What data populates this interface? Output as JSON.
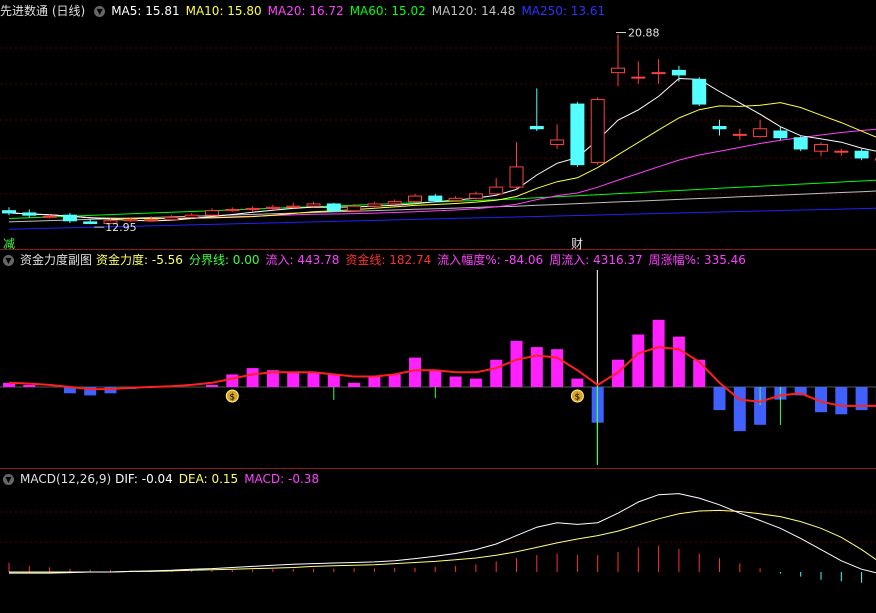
{
  "colors": {
    "bg": "#000000",
    "up": "#ff4040",
    "down": "#54ffff",
    "grid": "#5a0000",
    "ma5": "#ffffff",
    "ma10": "#ffff40",
    "ma20": "#ff40ff",
    "ma60": "#00ff00",
    "ma120": "#c0c0c0",
    "ma250": "#2020ff"
  },
  "panel1": {
    "name": "先进数通 (日线)",
    "ma": [
      {
        "label": "MA5: 15.81",
        "color": "#ffffff"
      },
      {
        "label": "MA10: 15.80",
        "color": "#ffff40"
      },
      {
        "label": "MA20: 16.72",
        "color": "#ff40ff"
      },
      {
        "label": "MA60: 15.02",
        "color": "#00ff00"
      },
      {
        "label": "MA120: 14.48",
        "color": "#c0c0c0"
      },
      {
        "label": "MA250: 13.61",
        "color": "#3030ff"
      }
    ],
    "high_label": "20.88",
    "low_label": "12.95",
    "marker_left": "减",
    "marker_mid": "财"
  },
  "panel2": {
    "name": "资金力度副图",
    "items": [
      {
        "label": "资金力度: -5.56",
        "color": "#ffff60"
      },
      {
        "label": "分界线: 0.00",
        "color": "#40ff40"
      },
      {
        "label": "流入: 443.78",
        "color": "#ff40ff"
      },
      {
        "label": "资金线: 182.74",
        "color": "#ff3030"
      },
      {
        "label": "流入幅度%: -84.06",
        "color": "#ff40ff"
      },
      {
        "label": "周流入: 4316.37",
        "color": "#ff40ff"
      },
      {
        "label": "周涨幅%: 335.46",
        "color": "#ff40ff"
      }
    ],
    "coin_glyph": "$"
  },
  "panel3": {
    "name": "MACD(12,26,9)",
    "items": [
      {
        "label": "DIF: -0.04",
        "color": "#ffffff"
      },
      {
        "label": "DEA: 0.15",
        "color": "#ffff60"
      },
      {
        "label": "MACD: -0.38",
        "color": "#ff40ff"
      }
    ]
  },
  "chart_data": [
    {
      "type": "candlestick",
      "title": "先进数通 (日线)",
      "candles": [
        {
          "o": 13.55,
          "c": 13.45,
          "h": 13.7,
          "l": 13.35
        },
        {
          "o": 13.45,
          "c": 13.35,
          "h": 13.6,
          "l": 13.25
        },
        {
          "o": 13.3,
          "c": 13.3,
          "h": 13.4,
          "l": 13.2
        },
        {
          "o": 13.35,
          "c": 13.1,
          "h": 13.45,
          "l": 13.0
        },
        {
          "o": 13.05,
          "c": 12.98,
          "h": 13.15,
          "l": 12.95
        },
        {
          "o": 12.98,
          "c": 13.1,
          "h": 13.2,
          "l": 12.95
        },
        {
          "o": 13.1,
          "c": 13.15,
          "h": 13.25,
          "l": 13.05
        },
        {
          "o": 13.15,
          "c": 13.15,
          "h": 13.3,
          "l": 13.1
        },
        {
          "o": 13.15,
          "c": 13.25,
          "h": 13.35,
          "l": 13.1
        },
        {
          "o": 13.25,
          "c": 13.35,
          "h": 13.45,
          "l": 13.2
        },
        {
          "o": 13.35,
          "c": 13.55,
          "h": 13.65,
          "l": 13.3
        },
        {
          "o": 13.55,
          "c": 13.6,
          "h": 13.7,
          "l": 13.5
        },
        {
          "o": 13.6,
          "c": 13.65,
          "h": 13.75,
          "l": 13.5
        },
        {
          "o": 13.65,
          "c": 13.7,
          "h": 13.8,
          "l": 13.6
        },
        {
          "o": 13.7,
          "c": 13.75,
          "h": 13.9,
          "l": 13.65
        },
        {
          "o": 13.75,
          "c": 13.85,
          "h": 13.95,
          "l": 13.7
        },
        {
          "o": 13.85,
          "c": 13.55,
          "h": 13.9,
          "l": 13.5
        },
        {
          "o": 13.55,
          "c": 13.75,
          "h": 13.85,
          "l": 13.5
        },
        {
          "o": 13.75,
          "c": 13.85,
          "h": 13.95,
          "l": 13.7
        },
        {
          "o": 13.85,
          "c": 13.95,
          "h": 14.05,
          "l": 13.8
        },
        {
          "o": 13.95,
          "c": 14.2,
          "h": 14.3,
          "l": 13.9
        },
        {
          "o": 14.2,
          "c": 14.0,
          "h": 14.3,
          "l": 13.95
        },
        {
          "o": 14.0,
          "c": 14.1,
          "h": 14.2,
          "l": 13.95
        },
        {
          "o": 14.1,
          "c": 14.3,
          "h": 14.4,
          "l": 14.05
        },
        {
          "o": 14.3,
          "c": 14.6,
          "h": 15.0,
          "l": 14.25
        },
        {
          "o": 14.6,
          "c": 15.5,
          "h": 16.6,
          "l": 14.5
        },
        {
          "o": 17.3,
          "c": 17.2,
          "h": 19.0,
          "l": 17.1
        },
        {
          "o": 16.5,
          "c": 16.7,
          "h": 17.4,
          "l": 16.3
        },
        {
          "o": 18.3,
          "c": 15.6,
          "h": 18.4,
          "l": 15.5
        },
        {
          "o": 15.7,
          "c": 18.5,
          "h": 18.6,
          "l": 15.6
        },
        {
          "o": 19.7,
          "c": 19.9,
          "h": 21.4,
          "l": 19.1
        },
        {
          "o": 19.5,
          "c": 19.5,
          "h": 20.2,
          "l": 19.2
        },
        {
          "o": 19.7,
          "c": 19.7,
          "h": 20.3,
          "l": 19.2
        },
        {
          "o": 19.8,
          "c": 19.6,
          "h": 20.0,
          "l": 19.3
        },
        {
          "o": 19.4,
          "c": 18.3,
          "h": 19.5,
          "l": 18.2
        },
        {
          "o": 17.3,
          "c": 17.2,
          "h": 17.6,
          "l": 16.9
        },
        {
          "o": 16.95,
          "c": 16.95,
          "h": 17.2,
          "l": 16.7
        },
        {
          "o": 16.85,
          "c": 17.2,
          "h": 17.6,
          "l": 16.8
        },
        {
          "o": 17.1,
          "c": 16.8,
          "h": 17.3,
          "l": 16.7
        },
        {
          "o": 16.8,
          "c": 16.3,
          "h": 16.9,
          "l": 16.2
        },
        {
          "o": 16.2,
          "c": 16.5,
          "h": 16.6,
          "l": 16.0
        },
        {
          "o": 16.2,
          "c": 16.2,
          "h": 16.3,
          "l": 16.0
        },
        {
          "o": 16.2,
          "c": 15.9,
          "h": 16.3,
          "l": 15.8
        },
        {
          "o": 15.85,
          "c": 15.85,
          "h": 16.0,
          "l": 15.7
        }
      ]
    },
    {
      "type": "bar",
      "title": "资金力度副图",
      "values": [
        0.1,
        0.05,
        0.0,
        -0.15,
        -0.2,
        -0.15,
        -0.05,
        0.0,
        0.0,
        0.0,
        0.05,
        0.3,
        0.45,
        0.4,
        0.35,
        0.35,
        0.3,
        0.1,
        0.25,
        0.3,
        0.7,
        0.4,
        0.25,
        0.2,
        0.65,
        1.1,
        0.95,
        0.9,
        0.2,
        -0.85,
        0.65,
        1.25,
        1.6,
        1.2,
        0.65,
        -0.55,
        -1.05,
        -0.9,
        -0.3,
        -0.2,
        -0.6,
        -0.65,
        -0.55,
        -0.5
      ],
      "line": [
        0.1,
        0.08,
        0.05,
        0.0,
        -0.05,
        -0.05,
        -0.02,
        0.0,
        0.02,
        0.05,
        0.1,
        0.2,
        0.3,
        0.35,
        0.35,
        0.35,
        0.3,
        0.25,
        0.25,
        0.3,
        0.4,
        0.4,
        0.35,
        0.35,
        0.45,
        0.65,
        0.75,
        0.7,
        0.4,
        0.05,
        0.35,
        0.8,
        0.95,
        0.9,
        0.6,
        0.1,
        -0.3,
        -0.35,
        -0.2,
        -0.15,
        -0.35,
        -0.45,
        -0.45,
        -0.45
      ]
    },
    {
      "type": "line",
      "title": "MACD(12,26,9)",
      "dif": [
        -0.02,
        -0.02,
        -0.02,
        -0.01,
        0.0,
        0.0,
        0.01,
        0.02,
        0.03,
        0.05,
        0.06,
        0.08,
        0.1,
        0.12,
        0.14,
        0.15,
        0.16,
        0.17,
        0.18,
        0.2,
        0.24,
        0.28,
        0.33,
        0.4,
        0.5,
        0.65,
        0.8,
        0.88,
        0.85,
        0.88,
        1.05,
        1.25,
        1.38,
        1.4,
        1.32,
        1.2,
        1.05,
        0.92,
        0.78,
        0.6,
        0.4,
        0.2,
        0.05,
        -0.04
      ],
      "dea": [
        0.0,
        0.0,
        0.0,
        0.0,
        0.0,
        0.0,
        0.01,
        0.01,
        0.02,
        0.03,
        0.04,
        0.05,
        0.06,
        0.07,
        0.08,
        0.1,
        0.11,
        0.12,
        0.13,
        0.15,
        0.17,
        0.19,
        0.22,
        0.25,
        0.3,
        0.36,
        0.44,
        0.52,
        0.59,
        0.65,
        0.73,
        0.84,
        0.95,
        1.04,
        1.09,
        1.1,
        1.08,
        1.04,
        0.99,
        0.9,
        0.78,
        0.62,
        0.4,
        0.15
      ],
      "macd": [
        0.3,
        0.2,
        0.15,
        0.1,
        0.08,
        0.06,
        0.05,
        0.05,
        0.05,
        0.06,
        0.06,
        0.07,
        0.08,
        0.09,
        0.1,
        0.11,
        0.11,
        0.12,
        0.12,
        0.13,
        0.14,
        0.16,
        0.2,
        0.25,
        0.35,
        0.45,
        0.55,
        0.6,
        0.55,
        0.55,
        0.65,
        0.8,
        0.85,
        0.75,
        0.6,
        0.45,
        0.28,
        0.12,
        -0.05,
        -0.15,
        -0.25,
        -0.3,
        -0.35,
        -0.38
      ]
    }
  ]
}
